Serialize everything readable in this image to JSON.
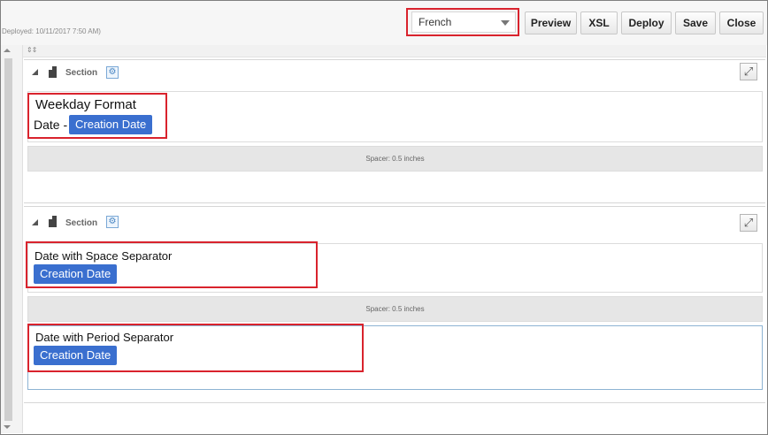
{
  "header": {
    "deployed_text": "Deployed: 10/11/2017 7:50 AM)",
    "language": {
      "selected": "French"
    },
    "buttons": {
      "preview": "Preview",
      "xsl": "XSL",
      "deploy": "Deploy",
      "save": "Save",
      "close": "Close"
    }
  },
  "sections": [
    {
      "label": "Section",
      "fields": [
        {
          "title": "Weekday Format",
          "prefix": "Date -",
          "chip": "Creation Date"
        }
      ],
      "spacer": "Spacer: 0.5 inches"
    },
    {
      "label": "Section",
      "fields": [
        {
          "title": "Date with Space Separator",
          "chip": "Creation Date"
        },
        {
          "title": "Date with Period Separator",
          "chip": "Creation Date"
        }
      ],
      "spacer": "Spacer: 0.5 inches"
    }
  ],
  "colors": {
    "highlight": "#d9232d",
    "chip": "#3a6fcf"
  }
}
